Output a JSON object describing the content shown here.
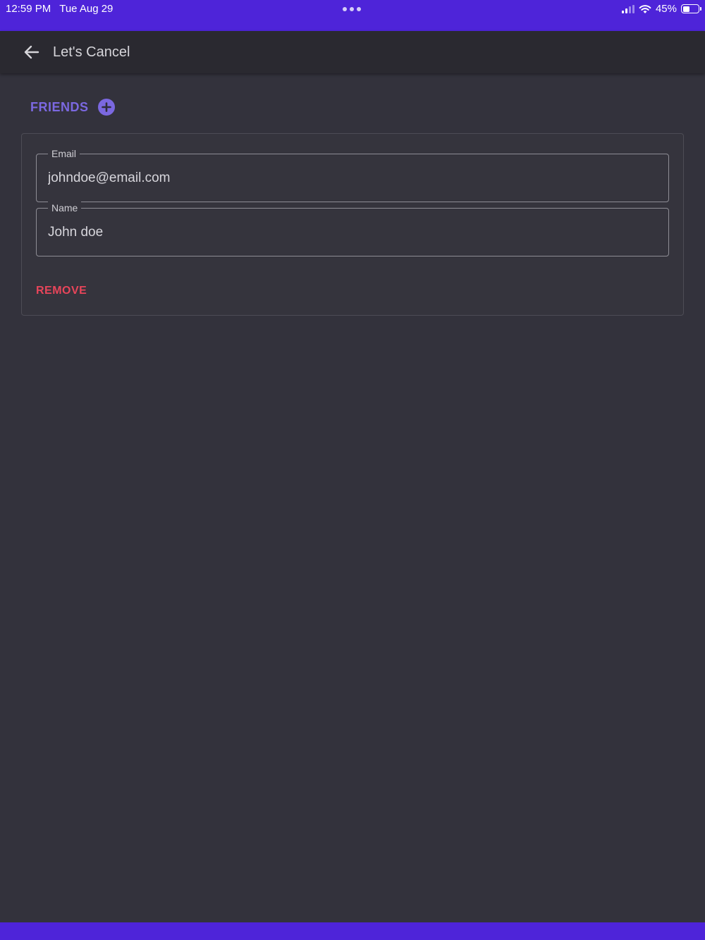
{
  "status_bar": {
    "time": "12:59 PM",
    "date": "Tue Aug 29",
    "battery_text": "45%",
    "battery_level": 0.45
  },
  "app_bar": {
    "title": "Let's Cancel",
    "back_icon": "arrow-left-icon"
  },
  "friends": {
    "header_label": "FRIENDS",
    "add_icon": "plus-circle-icon",
    "items": [
      {
        "email_label": "Email",
        "email_value": "johndoe@email.com",
        "name_label": "Name",
        "name_value": "John doe",
        "remove_label": "REMOVE"
      }
    ]
  },
  "colors": {
    "accent": "#4e24d9",
    "friends_label": "#7b68e0",
    "remove": "#e8455a",
    "background": "#33323c",
    "app_bar": "#2a2930"
  }
}
